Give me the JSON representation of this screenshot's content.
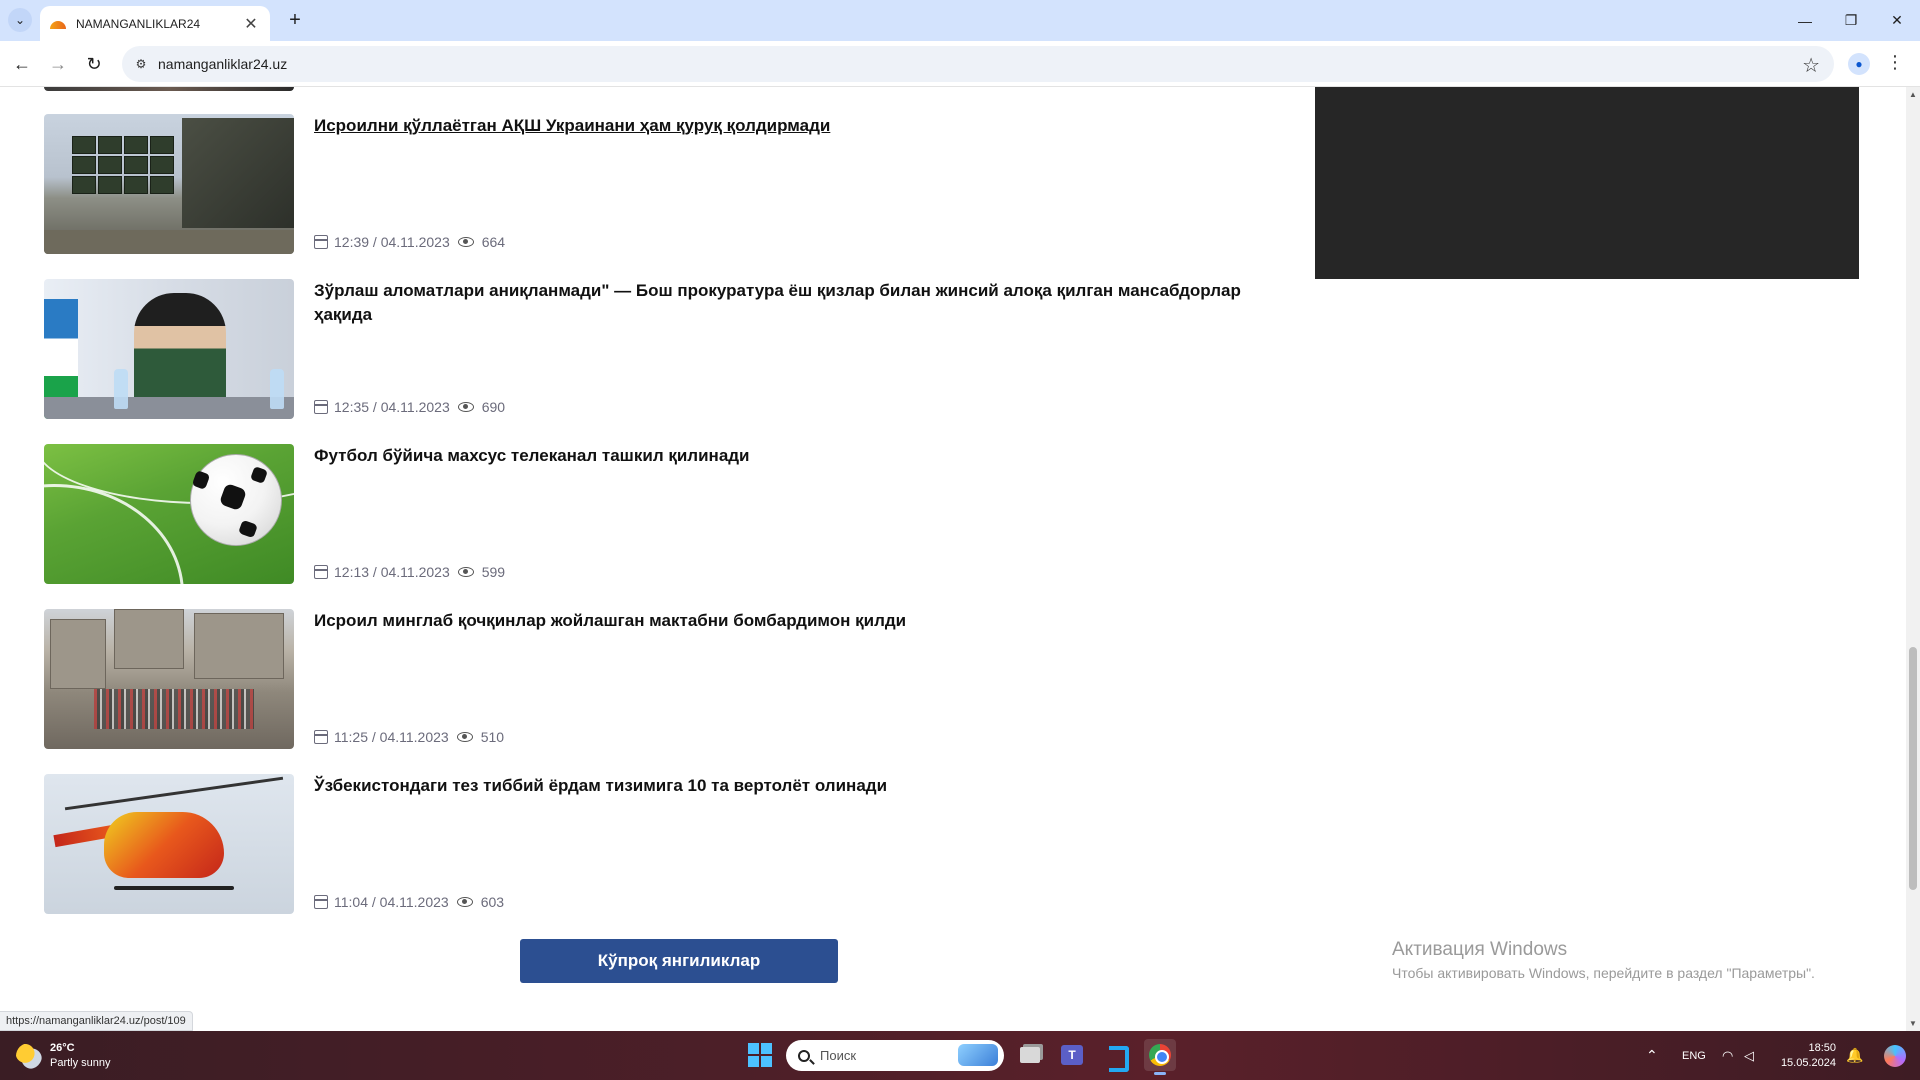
{
  "browser": {
    "tab_title": "NAMANGANLIKLAR24",
    "tab_close": "✕",
    "new_tab": "+",
    "url": "namanganliklar24.uz",
    "window_controls": {
      "minimize": "—",
      "restore": "❐",
      "close": "✕"
    },
    "status_url": "https://namanganliklar24.uz/post/109"
  },
  "news": [
    {
      "title": "Исроилни қўллаётган АҚШ Украинани ҳам қуруқ қолдирмади",
      "time": "12:39 / 04.11.2023",
      "views": "664"
    },
    {
      "title": "Зўрлаш аломатлари аниқланмади\" — Бош прокуратура ёш қизлар билан жинсий алоқа қилган мансабдорлар ҳақида",
      "time": "12:35 / 04.11.2023",
      "views": "690"
    },
    {
      "title": "Футбол бўйича махсус телеканал ташкил қилинади",
      "time": "12:13 / 04.11.2023",
      "views": "599"
    },
    {
      "title": "Исроил минглаб қочқинлар жойлашган мактабни бомбардимон қилди",
      "time": "11:25 / 04.11.2023",
      "views": "510"
    },
    {
      "title": "Ўзбекистондаги тез тиббий ёрдам тизимига 10 та вертолёт олинади",
      "time": "11:04 / 04.11.2023",
      "views": "603"
    }
  ],
  "more_button": "Кўпроқ янгиликлар",
  "windows_activation": {
    "title": "Активация Windows",
    "subtitle": "Чтобы активировать Windows, перейдите в раздел \"Параметры\"."
  },
  "taskbar": {
    "weather_temp": "26°C",
    "weather_desc": "Partly sunny",
    "search_placeholder": "Поиск",
    "teams_letter": "T",
    "language": "ENG",
    "time": "18:50",
    "date": "15.05.2024"
  }
}
